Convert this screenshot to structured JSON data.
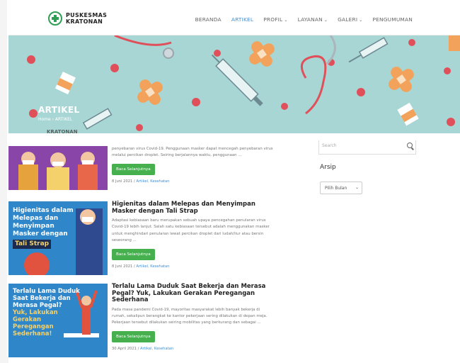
{
  "brand": {
    "line1": "PUSKESMAS",
    "line2": "KRATONAN"
  },
  "nav": [
    {
      "label": "BERANDA",
      "active": false,
      "dropdown": false
    },
    {
      "label": "ARTIKEL",
      "active": true,
      "dropdown": false
    },
    {
      "label": "PROFIL",
      "active": false,
      "dropdown": true
    },
    {
      "label": "LAYANAN",
      "active": false,
      "dropdown": true
    },
    {
      "label": "GALERI",
      "active": false,
      "dropdown": true
    },
    {
      "label": "PENGUMUMAN",
      "active": false,
      "dropdown": false
    }
  ],
  "banner": {
    "title": "ARTIKEL",
    "breadcrumb": "Home  ›  ARTIKEL"
  },
  "faded_logo": "KRATONAN",
  "posts": [
    {
      "title": "",
      "excerpt": "penyebaran virus Covid-19. Penggunaan masker dapat mencegah penyebaran virus melalui percikan droplet. Seiring berjalannya waktu, penggunaan ...",
      "button": "Baca Selanjutnya",
      "date": "8 Juni 2021",
      "categories": "Artikel, Kesehatan",
      "thumb_text": ""
    },
    {
      "title": "Higienitas dalam Melepas dan Menyimpan Masker dengan Tali Strap",
      "excerpt": "Adaptasi kebiasaan baru merupakan sebuah upaya pencegahan penularan virus Covid-19 lebih lanjut. Salah satu kebiasaan tersebut adalah menggunakan masker untuk menghindari penularan lewat percikan droplet dari ludah/liur atau bersin seseorang ...",
      "button": "Baca Selanjutnya",
      "date": "8 Juni 2021",
      "categories": "Artikel, Kesehatan",
      "thumb_lines": [
        "Higienitas dalam",
        "Melepas dan",
        "Menyimpan",
        "Masker dengan"
      ],
      "thumb_tag": "Tali Strap"
    },
    {
      "title": "Terlalu Lama Duduk Saat Bekerja dan Merasa Pegal? Yuk, Lakukan Gerakan Peregangan Sederhana",
      "excerpt": "Pada masa pandemi Covid-19, mayoritas masyarakat lebih banyak bekerja di rumah, sekalipun berangkat ke kantor pekerjaan sering dilakukan di depan meja. Pekerjaan tersebut dilakukan seiring mobilitas yang berkurang dan sebagai ...",
      "button": "Baca Selanjutnya",
      "date": "30 April 2021",
      "categories": "Artikel, Kesehatan",
      "thumb_lines": [
        "Terlalu Lama Duduk",
        "Saat Bekerja dan",
        "Merasa Pegal?"
      ],
      "thumb_lines2": [
        "Yuk, Lakukan",
        "Gerakan",
        "Peregangan",
        "Sederhana!"
      ]
    }
  ],
  "sidebar": {
    "search_placeholder": "Search",
    "archive_title": "Arsip",
    "archive_select": "Pilih Bulan"
  },
  "colors": {
    "accent": "#3f8fd2",
    "button": "#46b04f",
    "banner": "#a8d6d4"
  }
}
